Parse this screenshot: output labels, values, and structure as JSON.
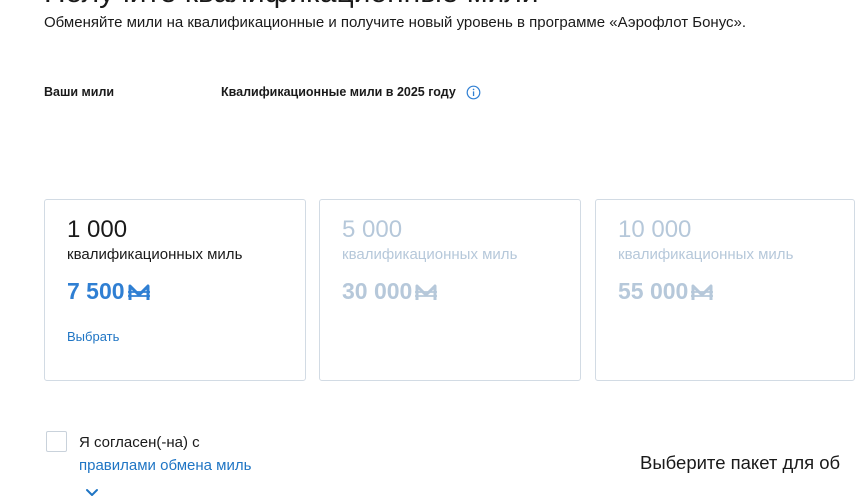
{
  "header": {
    "title": "Получите квалификационные мили",
    "subtitle": "Обменяйте мили на квалификационные и получите новый уровень в программе «Аэрофлот Бонус»."
  },
  "labels": {
    "your_miles": "Ваши мили",
    "qualifying_miles": "Квалификационные мили в 2025 году"
  },
  "packages": [
    {
      "amount": "1 000",
      "unit": "квалификационных миль",
      "price": "7 500",
      "action": "Выбрать",
      "state": "active"
    },
    {
      "amount": "5 000",
      "unit": "квалификационных миль",
      "price": "30 000",
      "state": "disabled"
    },
    {
      "amount": "10 000",
      "unit": "квалификационных миль",
      "price": "55 000",
      "state": "disabled"
    }
  ],
  "agreement": {
    "prefix": "Я согласен(-на) с",
    "link": "правилами обмена миль"
  },
  "hint": "Выберите пакет для об",
  "colors": {
    "link": "#1f75c4",
    "price_active": "#2f7fd3",
    "disabled": "#b6c8da",
    "border": "#d2dbe4"
  },
  "icons": {
    "info": "info-circle-icon",
    "currency": "mile-currency-icon",
    "expand": "chevron-down-icon"
  }
}
